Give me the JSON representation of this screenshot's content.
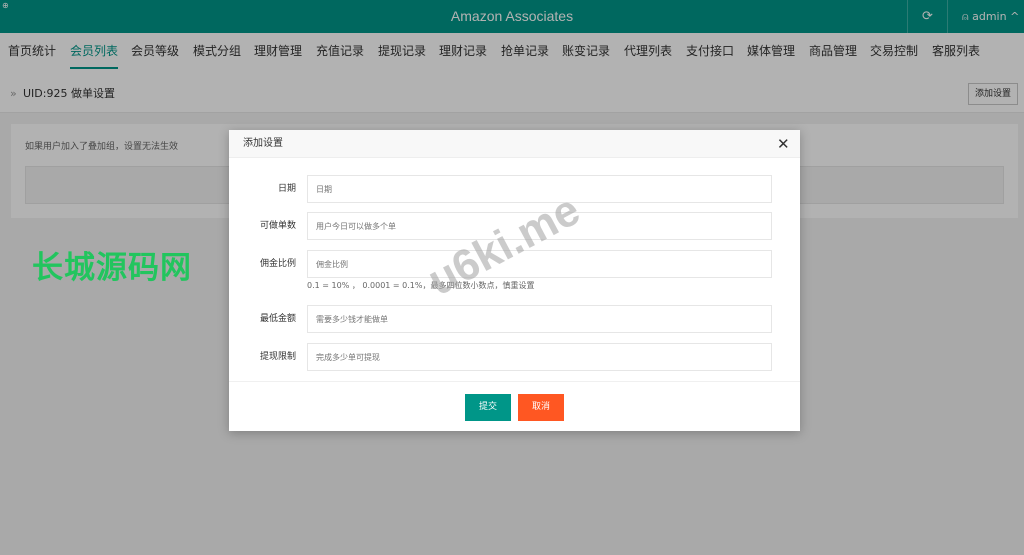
{
  "header": {
    "corner_icon": "⊕",
    "title": "Amazon Associates",
    "refresh_icon": "⟳",
    "user_icon": "⍝",
    "username": "admin",
    "chevron": "^"
  },
  "nav": {
    "items": [
      {
        "label": "首页统计"
      },
      {
        "label": "会员列表"
      },
      {
        "label": "会员等级"
      },
      {
        "label": "模式分组"
      },
      {
        "label": "理财管理"
      },
      {
        "label": "充值记录"
      },
      {
        "label": "提现记录"
      },
      {
        "label": "理财记录"
      },
      {
        "label": "抢单记录"
      },
      {
        "label": "账变记录"
      },
      {
        "label": "代理列表"
      },
      {
        "label": "支付接口"
      },
      {
        "label": "媒体管理"
      },
      {
        "label": "商品管理"
      },
      {
        "label": "交易控制"
      },
      {
        "label": "客服列表"
      }
    ],
    "active_index": 1
  },
  "breadcrumb": {
    "arrows": "»",
    "text": "UID:925 做单设置",
    "add_button": "添加设置"
  },
  "panel": {
    "notice": "如果用户加入了叠加组，设置无法生效"
  },
  "watermarks": {
    "cn": "长城源码网",
    "en": "u6ki.me"
  },
  "dialog": {
    "title": "添加设置",
    "close_icon": "✕",
    "fields": [
      {
        "label": "日期",
        "placeholder": "日期"
      },
      {
        "label": "可做单数",
        "placeholder": "用户今日可以做多个单"
      },
      {
        "label": "佣金比例",
        "placeholder": "佣金比例"
      },
      {
        "label": "最低金额",
        "placeholder": "需要多少钱才能做单"
      },
      {
        "label": "提现限制",
        "placeholder": "完成多少单可提现"
      }
    ],
    "hint": "0.1 = 10% ， 0.0001 = 0.1%，最多四位数小数点，慎重设置",
    "submit": "提交",
    "cancel": "取消"
  },
  "colors": {
    "brand": "#009688",
    "cancel": "#ff5722",
    "watermark_green": "#22c55e"
  }
}
